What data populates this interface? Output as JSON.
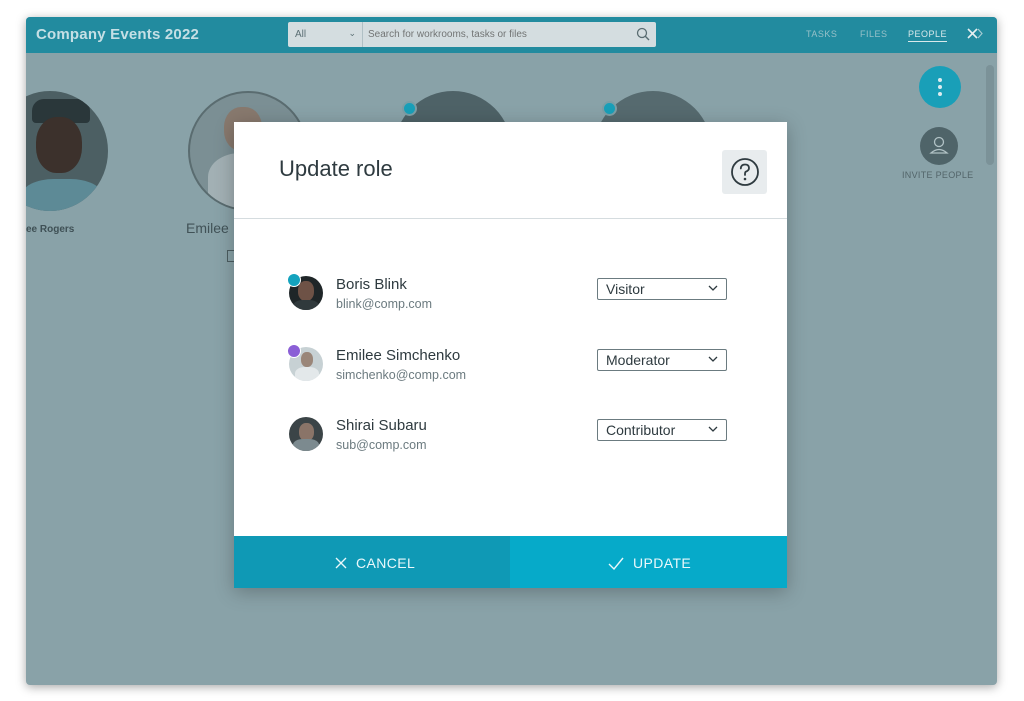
{
  "app": {
    "title": "Company Events 2022",
    "search": {
      "scope": "All",
      "placeholder": "Search for workrooms, tasks or files"
    },
    "nav": [
      "TASKS",
      "FILES",
      "PEOPLE"
    ],
    "active_nav": "PEOPLE"
  },
  "background": {
    "people": [
      {
        "name": "ee Rogers"
      },
      {
        "name": "Emilee"
      }
    ],
    "invite_label": "INVITE PEOPLE"
  },
  "modal": {
    "title": "Update role",
    "users": [
      {
        "name": "Boris Blink",
        "email": "blink@comp.com",
        "role": "Visitor",
        "badge_color": "#14a3be"
      },
      {
        "name": "Emilee Simchenko",
        "email": "simchenko@comp.com",
        "role": "Moderator",
        "badge_color": "#8b5fd6"
      },
      {
        "name": "Shirai Subaru",
        "email": "sub@comp.com",
        "role": "Contributor",
        "badge_color": ""
      }
    ],
    "cancel_label": "CANCEL",
    "update_label": "UPDATE"
  },
  "colors": {
    "accent": "#06aac9",
    "cancel": "#0f99b5",
    "topbar": "#1e8ea3"
  }
}
